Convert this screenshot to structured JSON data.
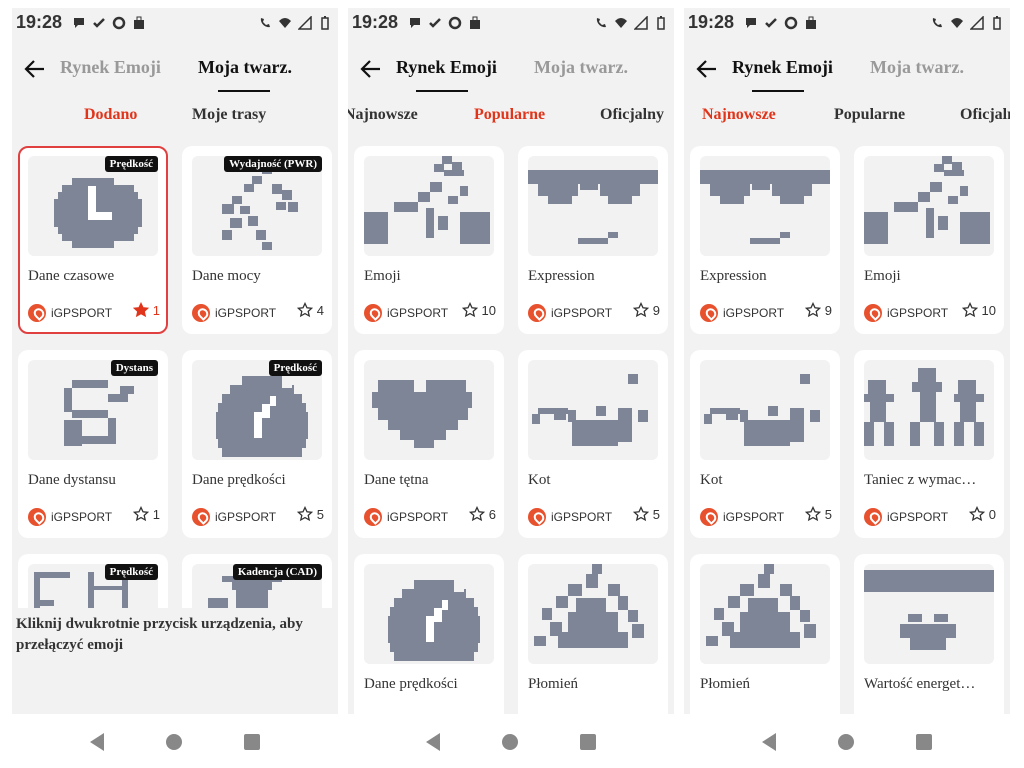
{
  "status_time": "19:28",
  "phones": [
    {
      "titles": [
        "Rynek Emoji",
        "Moja twarz."
      ],
      "active_title": 1,
      "subtabs": [
        "Dodano",
        "Moje trasy"
      ],
      "active_subtab": 0,
      "cards": [
        {
          "name": "Dane czasowe",
          "badge": "Prędkość",
          "source": "iGPSPORT",
          "count": "1",
          "art": "clock",
          "selected": true,
          "fav": true
        },
        {
          "name": "Dane mocy",
          "badge": "Wydajność (PWR)",
          "source": "iGPSPORT",
          "count": "4",
          "art": "power"
        },
        {
          "name": "Dane dystansu",
          "badge": "Dystans",
          "source": "iGPSPORT",
          "count": "1",
          "art": "distance"
        },
        {
          "name": "Dane prędkości",
          "badge": "Prędkość",
          "source": "iGPSPORT",
          "count": "5",
          "art": "speed"
        },
        {
          "name": "",
          "badge": "Prędkość",
          "source": "",
          "count": "",
          "art": "frame"
        },
        {
          "name": "",
          "badge": "Kadencja (CAD)",
          "source": "",
          "count": "",
          "art": "cadence"
        }
      ],
      "toast": "Kliknij dwukrotnie przycisk urządzenia, aby przełączyć emoji"
    },
    {
      "titles": [
        "Rynek Emoji",
        "Moja twarz."
      ],
      "active_title": 0,
      "subtabs": [
        "Najnowsze",
        "Popularne",
        "Oficjalny"
      ],
      "active_subtab": 1,
      "cards": [
        {
          "name": "Emoji",
          "badge": "",
          "source": "iGPSPORT",
          "count": "10",
          "art": "bike"
        },
        {
          "name": "Expression",
          "badge": "",
          "source": "iGPSPORT",
          "count": "9",
          "art": "glasses"
        },
        {
          "name": "Dane tętna",
          "badge": "",
          "source": "iGPSPORT",
          "count": "6",
          "art": "heart"
        },
        {
          "name": "Kot",
          "badge": "",
          "source": "iGPSPORT",
          "count": "5",
          "art": "cat"
        },
        {
          "name": "Dane prędkości",
          "badge": "",
          "source": "",
          "count": "",
          "art": "speed"
        },
        {
          "name": "Płomień",
          "badge": "",
          "source": "",
          "count": "",
          "art": "flame"
        }
      ]
    },
    {
      "titles": [
        "Rynek Emoji",
        "Moja twarz."
      ],
      "active_title": 0,
      "subtabs": [
        "Najnowsze",
        "Popularne",
        "Oficjalny"
      ],
      "active_subtab": 0,
      "cards": [
        {
          "name": "Expression",
          "badge": "",
          "source": "iGPSPORT",
          "count": "9",
          "art": "glasses"
        },
        {
          "name": "Emoji",
          "badge": "",
          "source": "iGPSPORT",
          "count": "10",
          "art": "bike"
        },
        {
          "name": "Kot",
          "badge": "",
          "source": "iGPSPORT",
          "count": "5",
          "art": "cat"
        },
        {
          "name": "Taniec z wymac…",
          "badge": "",
          "source": "iGPSPORT",
          "count": "0",
          "art": "dance"
        },
        {
          "name": "Płomień",
          "badge": "",
          "source": "",
          "count": "",
          "art": "flame"
        },
        {
          "name": "Wartość energet…",
          "badge": "",
          "source": "",
          "count": "",
          "art": "energy"
        }
      ]
    }
  ],
  "colors": {
    "accent": "#e0351b",
    "pixel_art": "#7d8597",
    "card_bg": "#ffffff",
    "screen_bg": "#f2f2f2"
  },
  "icons": [
    "back-arrow-icon",
    "star-icon",
    "igpsport-logo-icon",
    "nav-back-icon",
    "nav-home-icon",
    "nav-recents-icon",
    "wifi-icon",
    "signal-icon",
    "battery-icon"
  ]
}
